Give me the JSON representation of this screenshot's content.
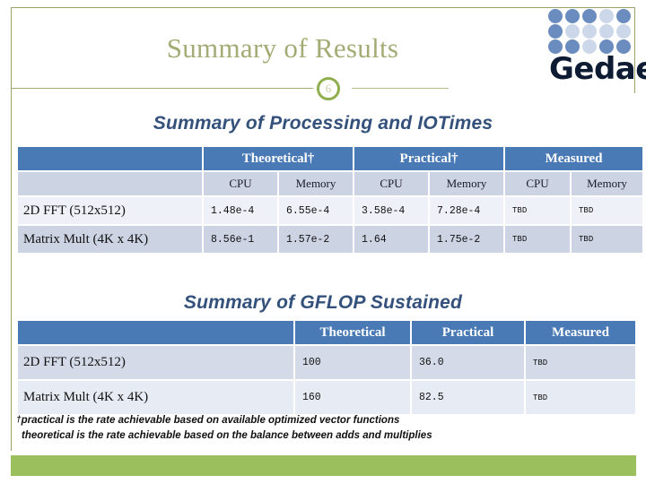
{
  "slide": {
    "title": "Summary of Results",
    "page_number": "6",
    "accent_olive": "#a4ab74",
    "accent_green": "#9cbf5e",
    "header_blue": "#4a7ab5",
    "heading_blue": "#33517b"
  },
  "logo": {
    "wordmark": "Gedae",
    "dot_rows": [
      [
        "dark",
        "dark",
        "dark",
        "light",
        "dark"
      ],
      [
        "dark",
        "light",
        "light",
        "light",
        "light"
      ],
      [
        "dark",
        "dark",
        "light",
        "dark",
        "dark"
      ]
    ],
    "dot_dark_color": "#6b8cbe",
    "dot_light_color": "#ccd8e9"
  },
  "io_table": {
    "heading": "Summary of Processing and IOTimes",
    "group_headers": [
      "",
      "Theoretical†",
      "Practical†",
      "Measured"
    ],
    "sub_headers": [
      "",
      "CPU",
      "Memory",
      "CPU",
      "Memory",
      "CPU",
      "Memory"
    ],
    "rows": [
      {
        "label": "2D FFT (512x512)",
        "theoretical_cpu": "1.48e-4",
        "theoretical_memory": "6.55e-4",
        "practical_cpu": "3.58e-4",
        "practical_memory": "7.28e-4",
        "measured_cpu": "TBD",
        "measured_memory": "TBD"
      },
      {
        "label": "Matrix Mult (4K x 4K)",
        "theoretical_cpu": "8.56e-1",
        "theoretical_memory": "1.57e-2",
        "practical_cpu": "1.64",
        "practical_memory": "1.75e-2",
        "measured_cpu": "TBD",
        "measured_memory": "TBD"
      }
    ]
  },
  "gflop_table": {
    "heading": "Summary of GFLOP Sustained",
    "headers": [
      "",
      "Theoretical",
      "Practical",
      "Measured"
    ],
    "rows": [
      {
        "label": "2D FFT (512x512)",
        "theoretical": "100",
        "practical": "36.0",
        "measured": "TBD"
      },
      {
        "label": "Matrix Mult (4K x 4K)",
        "theoretical": "160",
        "practical": "82.5",
        "measured": "TBD"
      }
    ]
  },
  "footnote": {
    "dagger": "†",
    "line1": "practical is the rate achievable based on available optimized vector functions",
    "line2": "theoretical is the rate achievable based on the balance between adds and multiplies"
  }
}
